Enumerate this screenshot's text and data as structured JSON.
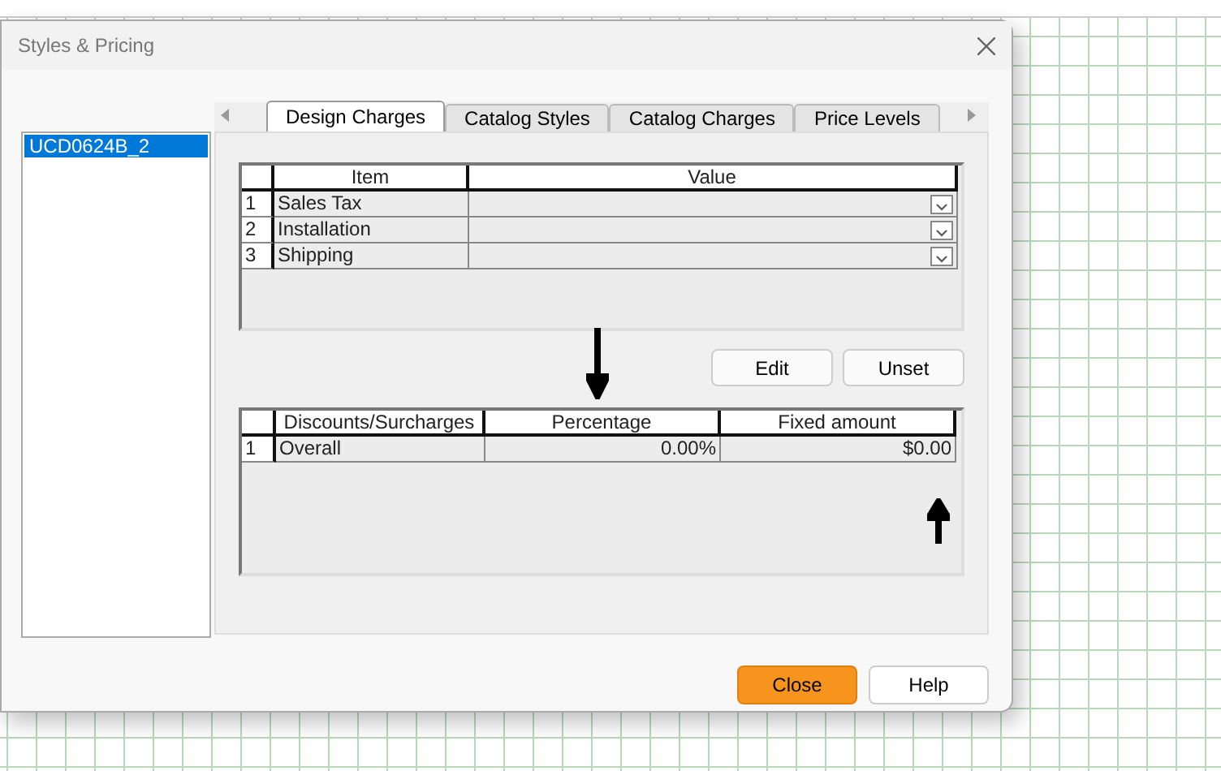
{
  "window": {
    "title": "Styles & Pricing"
  },
  "styles_list": [
    {
      "label": "UCD0624B_2",
      "selected": true
    }
  ],
  "tabs": [
    {
      "label": "Design Charges",
      "selected": true
    },
    {
      "label": "Catalog Styles",
      "selected": false
    },
    {
      "label": "Catalog Charges",
      "selected": false
    },
    {
      "label": "Price Levels",
      "selected": false
    }
  ],
  "charges_table": {
    "columns": [
      "Item",
      "Value"
    ],
    "rows": [
      {
        "number": "1",
        "item": "Sales Tax"
      },
      {
        "number": "2",
        "item": "Installation"
      },
      {
        "number": "3",
        "item": "Shipping"
      }
    ]
  },
  "table_buttons": [
    "Edit",
    "Unset"
  ],
  "discounts_table": {
    "columns": [
      "Discounts/Surcharges",
      "Percentage",
      "Fixed amount"
    ],
    "rows": [
      {
        "number": "1",
        "name": "Overall",
        "percentage": "0.00%",
        "fixed_amount": "$0.00"
      }
    ]
  },
  "buttons": [
    {
      "label": "Close",
      "kind": "primary"
    },
    {
      "label": "Help",
      "kind": "secondary"
    }
  ]
}
